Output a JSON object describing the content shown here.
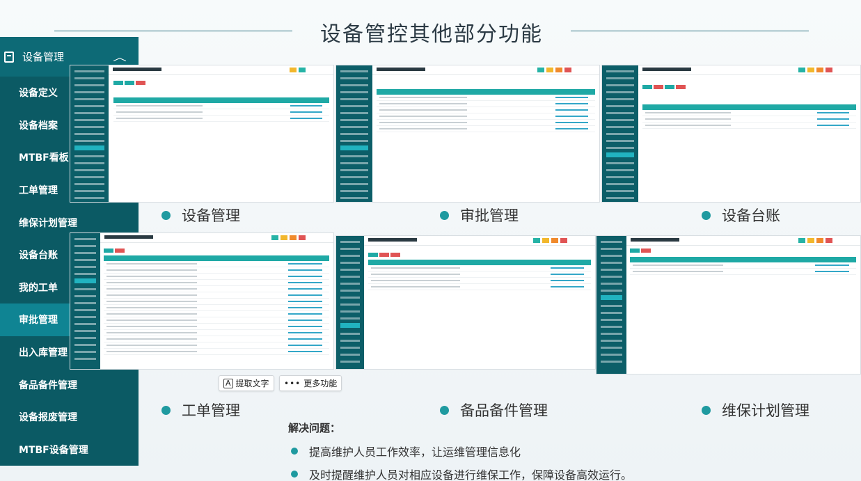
{
  "page": {
    "title": "设备管控其他部分功能"
  },
  "nav": {
    "header": "设备管理",
    "items": [
      "设备定义",
      "设备档案",
      "MTBF看板",
      "工单管理",
      "维保计划管理",
      "设备台账",
      "我的工单",
      "审批管理",
      "出入库管理",
      "备品备件管理",
      "设备报废管理",
      "MTBF设备管理"
    ],
    "active_index": 7
  },
  "modules": {
    "equipment_mgmt": "设备管理",
    "approval_mgmt": "审批管理",
    "equipment_ledger": "设备台账",
    "work_order_mgmt": "工单管理",
    "spare_parts_mgmt": "备品备件管理",
    "maintenance_plan_mgmt": "维保计划管理"
  },
  "toolbar": {
    "extract_text": "提取文字",
    "more_features": "更多功能"
  },
  "solution": {
    "title": "解决问题：",
    "points": [
      "提高维护人员工作效率，让运维管理信息化",
      "及时提醒维护人员对相应设备进行维保工作，保障设备高效运行。"
    ]
  },
  "colors": {
    "nav_bg": "#0e5f6a",
    "nav_active": "#0f8493",
    "accent": "#1f9aa0",
    "table_header": "#1fa9a5"
  }
}
